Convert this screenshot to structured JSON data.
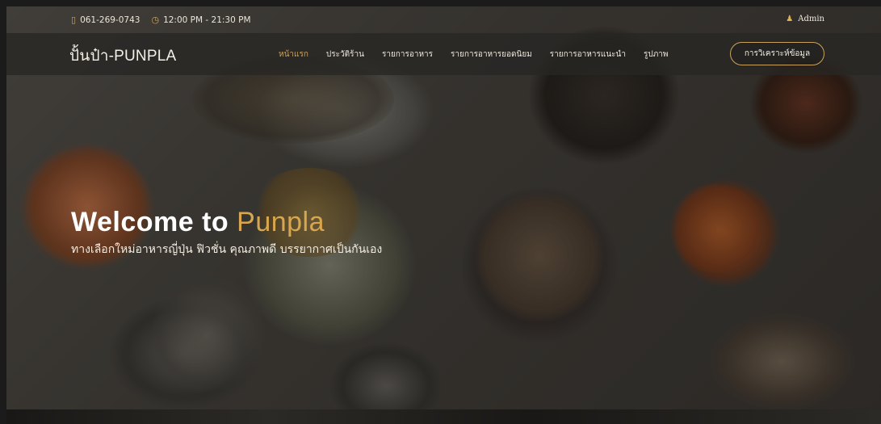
{
  "topbar": {
    "phone": "061-269-0743",
    "hours": "12:00 PM - 21:30 PM",
    "user": "Admin"
  },
  "brand": {
    "name": "ปั้นป๋า-PUNPLA"
  },
  "nav": {
    "items": [
      {
        "label": "หน้าแรก",
        "active": true
      },
      {
        "label": "ประวัติร้าน"
      },
      {
        "label": "รายการอาหาร"
      },
      {
        "label": "รายการอาหารยอดนิยม"
      },
      {
        "label": "รายการอาหารแนะนำ"
      },
      {
        "label": "รูปภาพ"
      }
    ],
    "cta_label": "การวิเคราะห์ข้อมูล"
  },
  "hero": {
    "title_prefix": "Welcome to ",
    "title_accent": "Punpla",
    "subtitle": "ทางเลือกใหม่อาหารญี่ปุ่น ฟิวชั่น คุณภาพดี บรรยากาศเป็นกันเอง"
  },
  "colors": {
    "accent": "#c9a25a",
    "navbar_bg": "rgba(40,38,36,0.78)"
  },
  "icons": {
    "phone": "phone-icon",
    "clock": "clock-icon",
    "user": "user-icon"
  }
}
